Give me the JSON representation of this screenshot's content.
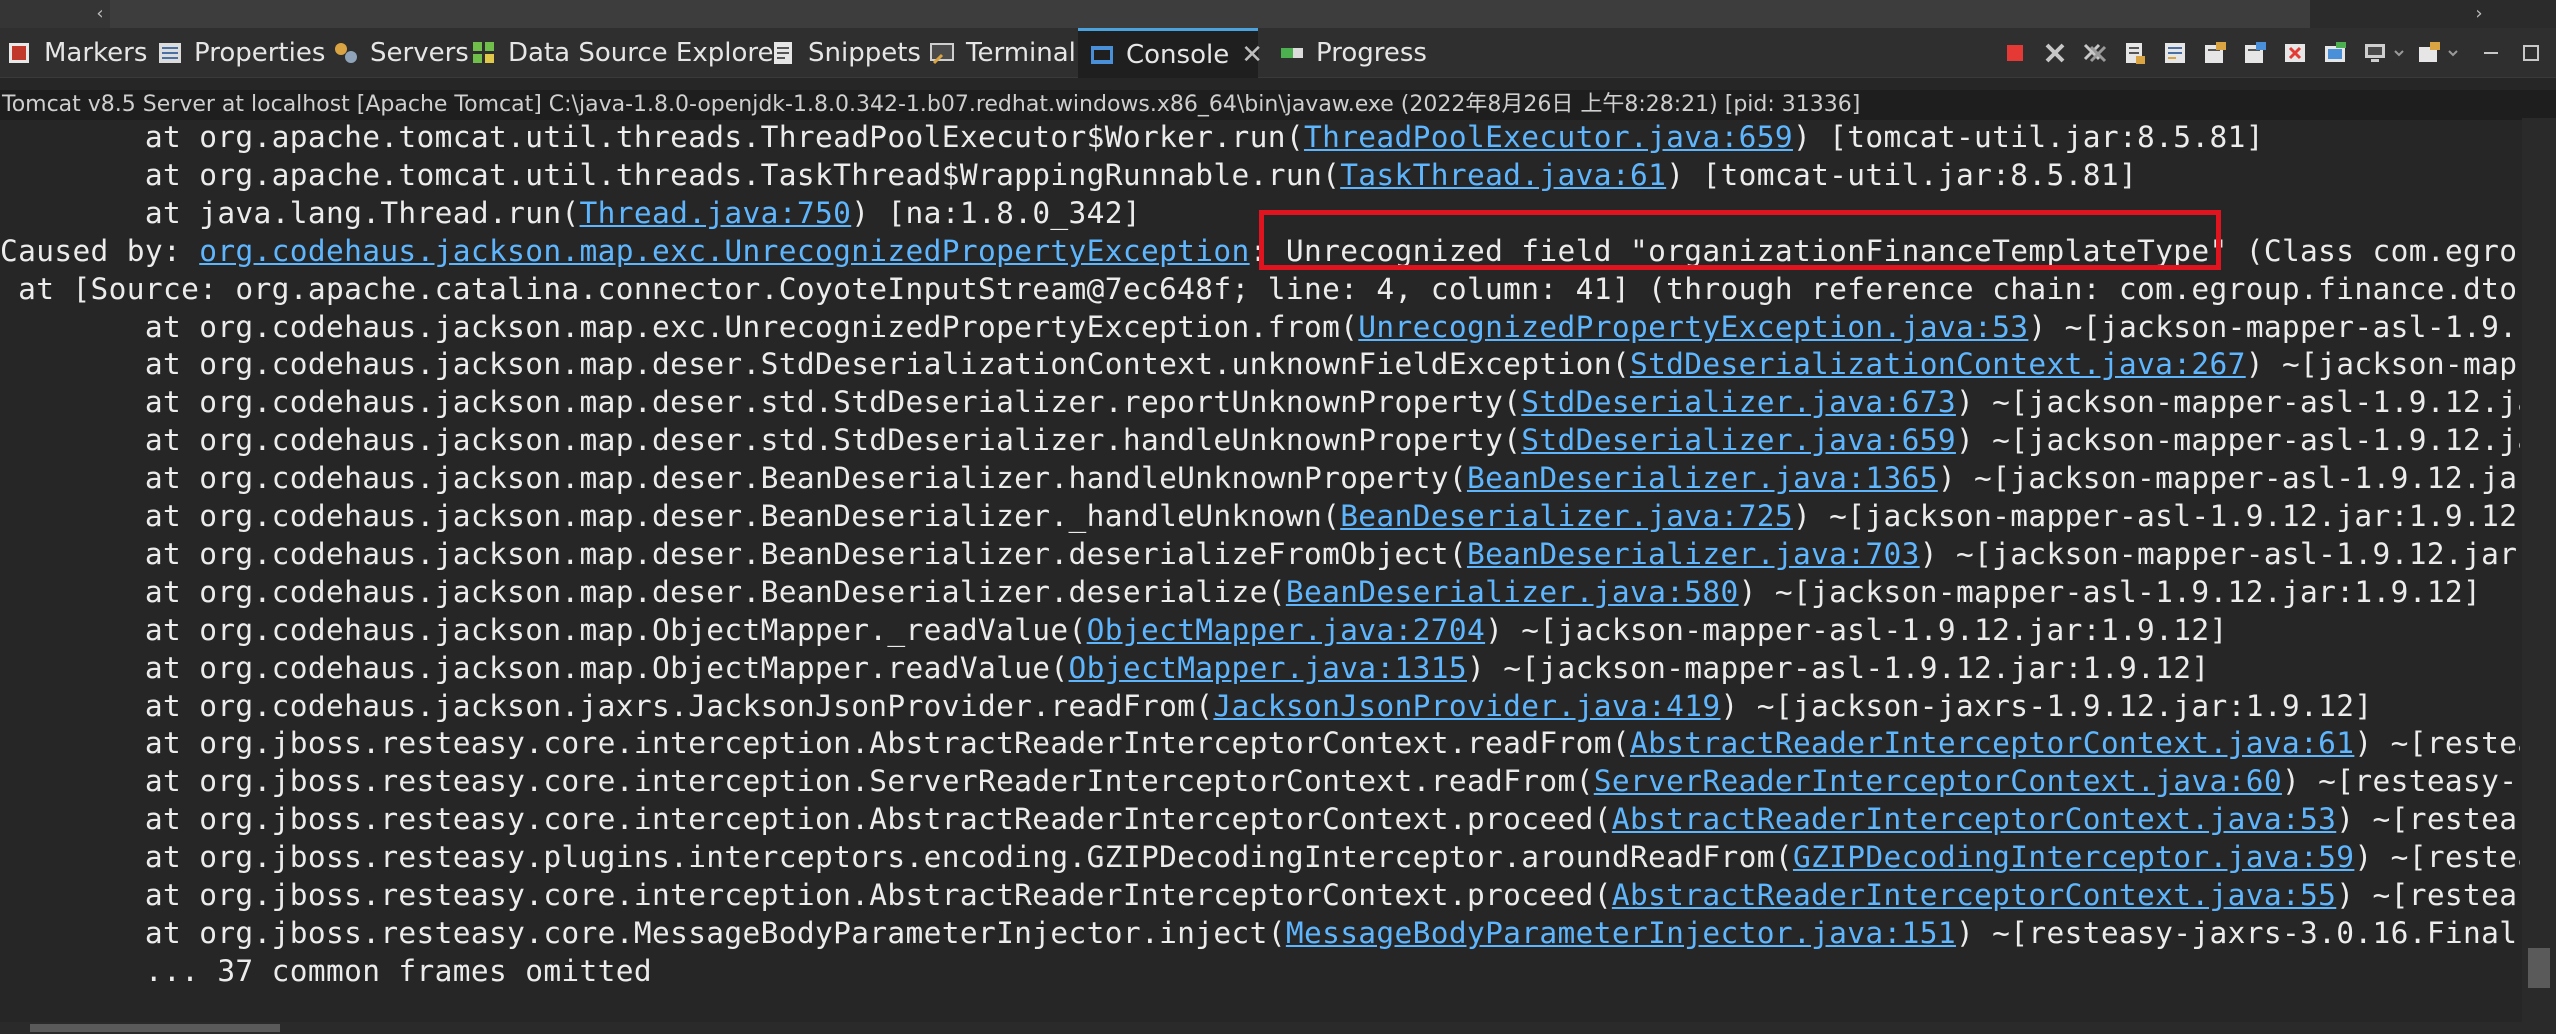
{
  "tabs": [
    {
      "id": "markers",
      "label": "Markers",
      "icon": "markers-icon",
      "active": false
    },
    {
      "id": "properties",
      "label": "Properties",
      "icon": "properties-icon",
      "active": false
    },
    {
      "id": "servers",
      "label": "Servers",
      "icon": "servers-icon",
      "active": false
    },
    {
      "id": "data-source-explorer",
      "label": "Data Source Explorer",
      "icon": "database-icon",
      "active": false
    },
    {
      "id": "snippets",
      "label": "Snippets",
      "icon": "snippets-icon",
      "active": false
    },
    {
      "id": "terminal",
      "label": "Terminal",
      "icon": "terminal-icon",
      "active": false
    },
    {
      "id": "console",
      "label": "Console",
      "icon": "console-icon",
      "active": true
    },
    {
      "id": "progress",
      "label": "Progress",
      "icon": "progress-icon",
      "active": false
    }
  ],
  "toolbar": {
    "icons": [
      "terminate-icon",
      "remove-launch-icon",
      "remove-all-icon",
      "scroll-lock-icon",
      "word-wrap-icon",
      "show-on-output-icon",
      "show-on-error-icon",
      "clear-console-icon",
      "pin-console-icon",
      "display-console-icon",
      "open-console-icon",
      "minimize-icon",
      "maximize-icon"
    ]
  },
  "status": "Tomcat v8.5 Server at localhost [Apache Tomcat] C:\\java-1.8.0-openjdk-1.8.0.342-1.b07.redhat.windows.x86_64\\bin\\javaw.exe  (2022年8月26日 上午8:28:21) [pid: 31336]",
  "console": {
    "lines": [
      {
        "pre": "        at org.apache.tomcat.util.threads.ThreadPoolExecutor$Worker.run(",
        "link": "ThreadPoolExecutor.java:659",
        "post": ") [tomcat-util.jar:8.5.81]"
      },
      {
        "pre": "        at org.apache.tomcat.util.threads.TaskThread$WrappingRunnable.run(",
        "link": "TaskThread.java:61",
        "post": ") [tomcat-util.jar:8.5.81]"
      },
      {
        "pre": "        at java.lang.Thread.run(",
        "link": "Thread.java:750",
        "post": ") [na:1.8.0_342]"
      },
      {
        "pre": "Caused by: ",
        "link": "org.codehaus.jackson.map.exc.UnrecognizedPropertyException",
        "post": ": Unrecognized field \"organizationFinanceTemplateType\" (Class com.egroup"
      },
      {
        "pre": " at [Source: org.apache.catalina.connector.CoyoteInputStream@7ec648f; line: 4, column: 41] (through reference chain: com.egroup.finance.dto.",
        "link": "",
        "post": ""
      },
      {
        "pre": "        at org.codehaus.jackson.map.exc.UnrecognizedPropertyException.from(",
        "link": "UnrecognizedPropertyException.java:53",
        "post": ") ~[jackson-mapper-asl-1.9.1"
      },
      {
        "pre": "        at org.codehaus.jackson.map.deser.StdDeserializationContext.unknownFieldException(",
        "link": "StdDeserializationContext.java:267",
        "post": ") ~[jackson-mapp"
      },
      {
        "pre": "        at org.codehaus.jackson.map.deser.std.StdDeserializer.reportUnknownProperty(",
        "link": "StdDeserializer.java:673",
        "post": ") ~[jackson-mapper-asl-1.9.12.ja"
      },
      {
        "pre": "        at org.codehaus.jackson.map.deser.std.StdDeserializer.handleUnknownProperty(",
        "link": "StdDeserializer.java:659",
        "post": ") ~[jackson-mapper-asl-1.9.12.ja"
      },
      {
        "pre": "        at org.codehaus.jackson.map.deser.BeanDeserializer.handleUnknownProperty(",
        "link": "BeanDeserializer.java:1365",
        "post": ") ~[jackson-mapper-asl-1.9.12.jar"
      },
      {
        "pre": "        at org.codehaus.jackson.map.deser.BeanDeserializer._handleUnknown(",
        "link": "BeanDeserializer.java:725",
        "post": ") ~[jackson-mapper-asl-1.9.12.jar:1.9.12]"
      },
      {
        "pre": "        at org.codehaus.jackson.map.deser.BeanDeserializer.deserializeFromObject(",
        "link": "BeanDeserializer.java:703",
        "post": ") ~[jackson-mapper-asl-1.9.12.jar:"
      },
      {
        "pre": "        at org.codehaus.jackson.map.deser.BeanDeserializer.deserialize(",
        "link": "BeanDeserializer.java:580",
        "post": ") ~[jackson-mapper-asl-1.9.12.jar:1.9.12]"
      },
      {
        "pre": "        at org.codehaus.jackson.map.ObjectMapper._readValue(",
        "link": "ObjectMapper.java:2704",
        "post": ") ~[jackson-mapper-asl-1.9.12.jar:1.9.12]"
      },
      {
        "pre": "        at org.codehaus.jackson.map.ObjectMapper.readValue(",
        "link": "ObjectMapper.java:1315",
        "post": ") ~[jackson-mapper-asl-1.9.12.jar:1.9.12]"
      },
      {
        "pre": "        at org.codehaus.jackson.jaxrs.JacksonJsonProvider.readFrom(",
        "link": "JacksonJsonProvider.java:419",
        "post": ") ~[jackson-jaxrs-1.9.12.jar:1.9.12]"
      },
      {
        "pre": "        at org.jboss.resteasy.core.interception.AbstractReaderInterceptorContext.readFrom(",
        "link": "AbstractReaderInterceptorContext.java:61",
        "post": ") ~[restea"
      },
      {
        "pre": "        at org.jboss.resteasy.core.interception.ServerReaderInterceptorContext.readFrom(",
        "link": "ServerReaderInterceptorContext.java:60",
        "post": ") ~[resteasy-j"
      },
      {
        "pre": "        at org.jboss.resteasy.core.interception.AbstractReaderInterceptorContext.proceed(",
        "link": "AbstractReaderInterceptorContext.java:53",
        "post": ") ~[resteas"
      },
      {
        "pre": "        at org.jboss.resteasy.plugins.interceptors.encoding.GZIPDecodingInterceptor.aroundReadFrom(",
        "link": "GZIPDecodingInterceptor.java:59",
        "post": ") ~[restea"
      },
      {
        "pre": "        at org.jboss.resteasy.core.interception.AbstractReaderInterceptorContext.proceed(",
        "link": "AbstractReaderInterceptorContext.java:55",
        "post": ") ~[resteas"
      },
      {
        "pre": "        at org.jboss.resteasy.core.MessageBodyParameterInjector.inject(",
        "link": "MessageBodyParameterInjector.java:151",
        "post": ") ~[resteasy-jaxrs-3.0.16.Final."
      },
      {
        "pre": "        ... 37 common frames omitted",
        "link": "",
        "post": ""
      }
    ]
  },
  "colors": {
    "console_bg": "#262626",
    "link": "#5eb6ff",
    "highlight_border": "#e0141e",
    "active_tab_accent": "#4aa3df"
  }
}
